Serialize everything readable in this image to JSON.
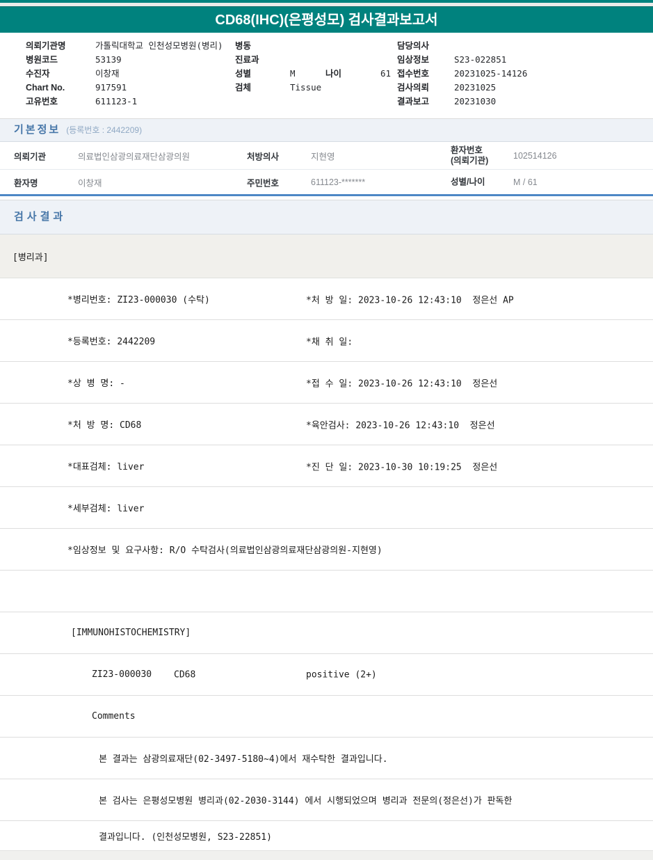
{
  "report": {
    "title": "CD68(IHC)(은평성모) 검사결과보고서"
  },
  "accent_colors": {
    "banner_teal": "#00827E",
    "section_title_blue": "#4676A8",
    "table_accent_blue": "#4D87C5"
  },
  "patient_header": {
    "left": [
      {
        "label": "의뢰기관명",
        "value": "가톨릭대학교 인천성모병원(병리)"
      },
      {
        "label": "병원코드",
        "value": "53139"
      },
      {
        "label": "수진자",
        "value": "이창재"
      },
      {
        "label": "Chart No.",
        "value": "917591"
      },
      {
        "label": "고유번호",
        "value": "611123-1"
      }
    ],
    "middle": [
      {
        "label": "병동",
        "value": ""
      },
      {
        "label": "진료과",
        "value": ""
      },
      {
        "label": "성별",
        "value": "M",
        "label2": "나이",
        "value2": "61"
      },
      {
        "label": "검체",
        "value": "Tissue"
      }
    ],
    "right": [
      {
        "label": "담당의사",
        "value": ""
      },
      {
        "label": "임상정보",
        "value": "S23-022851"
      },
      {
        "label": "접수번호",
        "value": "20231025-14126"
      },
      {
        "label": "검사의뢰",
        "value": "20231025"
      },
      {
        "label": "결과보고",
        "value": "20231030"
      }
    ]
  },
  "basic_info": {
    "title": "기본정보",
    "subtitle": "(등록번호 : 2442209)",
    "row1": {
      "label1": "의뢰기관",
      "value1": "의료법인삼광의료재단삼광의원",
      "label2": "처방의사",
      "value2": "지현영",
      "label3": "환자번호\n(의뢰기관)",
      "value3": "102514126"
    },
    "row2": {
      "label1": "환자명",
      "value1": "이창재",
      "label2": "주민번호",
      "value2": "611123-*******",
      "label3": "성별/나이",
      "value3": "M / 61"
    }
  },
  "results": {
    "title": "검사결과",
    "department": "[병리과]",
    "fields": [
      {
        "left": "*병리번호: ZI23-000030 (수탁)",
        "right": "*처 방 일: 2023-10-26 12:43:10  정은선 AP"
      },
      {
        "left": "*등록번호: 2442209",
        "right": "*채 취 일:"
      },
      {
        "left": "*상 병 명: -",
        "right": "*접 수 일: 2023-10-26 12:43:10  정은선"
      },
      {
        "left": "*처 방 명: CD68",
        "right": "*육안검사: 2023-10-26 12:43:10  정은선"
      },
      {
        "left": "*대표검체: liver",
        "right": "*진 단 일: 2023-10-30 10:19:25  정은선"
      },
      {
        "left": "*세부검체: liver",
        "right": ""
      }
    ],
    "clinical_info": "*임상정보 및 요구사항: R/O 수탁검사(의료법인삼광의료재단삼광의원-지현영)",
    "ihc_section": "[IMMUNOHISTOCHEMISTRY]",
    "ihc_row": {
      "specimen_no": "ZI23-000030",
      "test_name": "CD68",
      "result": "positive (2+)"
    },
    "comments_label": "Comments",
    "comments": [
      "본 결과는 삼광의료재단(02-3497-5180~4)에서 재수탁한 결과입니다.",
      "본 검사는 은평성모병원 병리과(02-2030-3144) 에서 시행되었으며 병리과 전문의(정은선)가 판독한",
      "결과입니다. (인천성모병원, S23-22851)"
    ]
  }
}
